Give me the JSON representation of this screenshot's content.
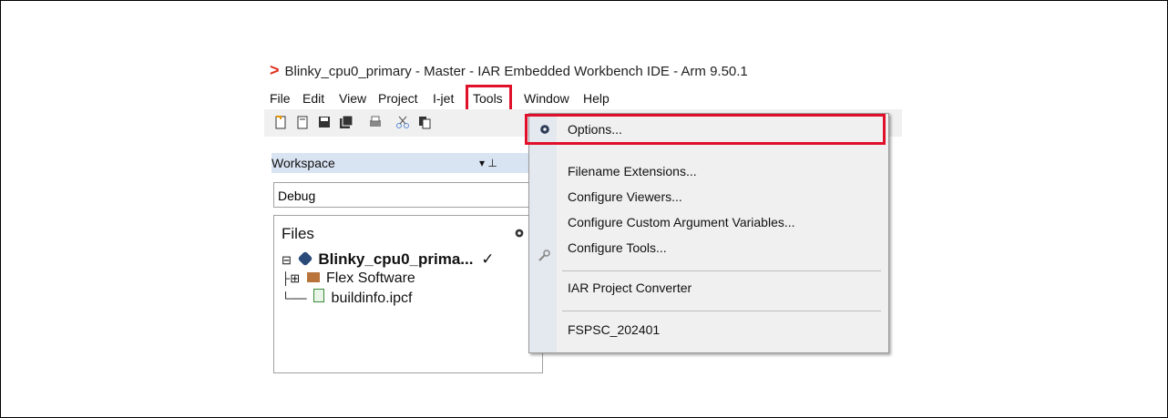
{
  "window": {
    "title": "Blinky_cpu0_primary - Master - IAR Embedded Workbench IDE - Arm 9.50.1",
    "logo_glyph": ">"
  },
  "menubar": {
    "items": [
      "File",
      "Edit",
      "View",
      "Project",
      "I-jet",
      "Tools",
      "Window",
      "Help"
    ]
  },
  "workspace": {
    "title": "Workspace",
    "pin_glyphs": "▾ ⊥",
    "config_value": "Debug",
    "files_header": "Files",
    "tree": [
      {
        "label": "Blinky_cpu0_prima...",
        "check": "✓"
      },
      {
        "label": "Flex Software"
      },
      {
        "label": "buildinfo.ipcf"
      }
    ]
  },
  "tools_menu": {
    "items": [
      "Options...",
      "Filename Extensions...",
      "Configure Viewers...",
      "Configure Custom Argument Variables...",
      "Configure Tools...",
      "IAR Project Converter",
      "FSPSC_202401"
    ]
  },
  "colors": {
    "highlight": "#e0102a",
    "logo": "#e0301e",
    "workspace_header": "#d9e4f2"
  },
  "icons": [
    "gear-icon",
    "tools-icon",
    "new-file-icon",
    "open-icon",
    "save-icon",
    "save-all-icon",
    "print-icon",
    "cut-icon",
    "copy-icon"
  ]
}
